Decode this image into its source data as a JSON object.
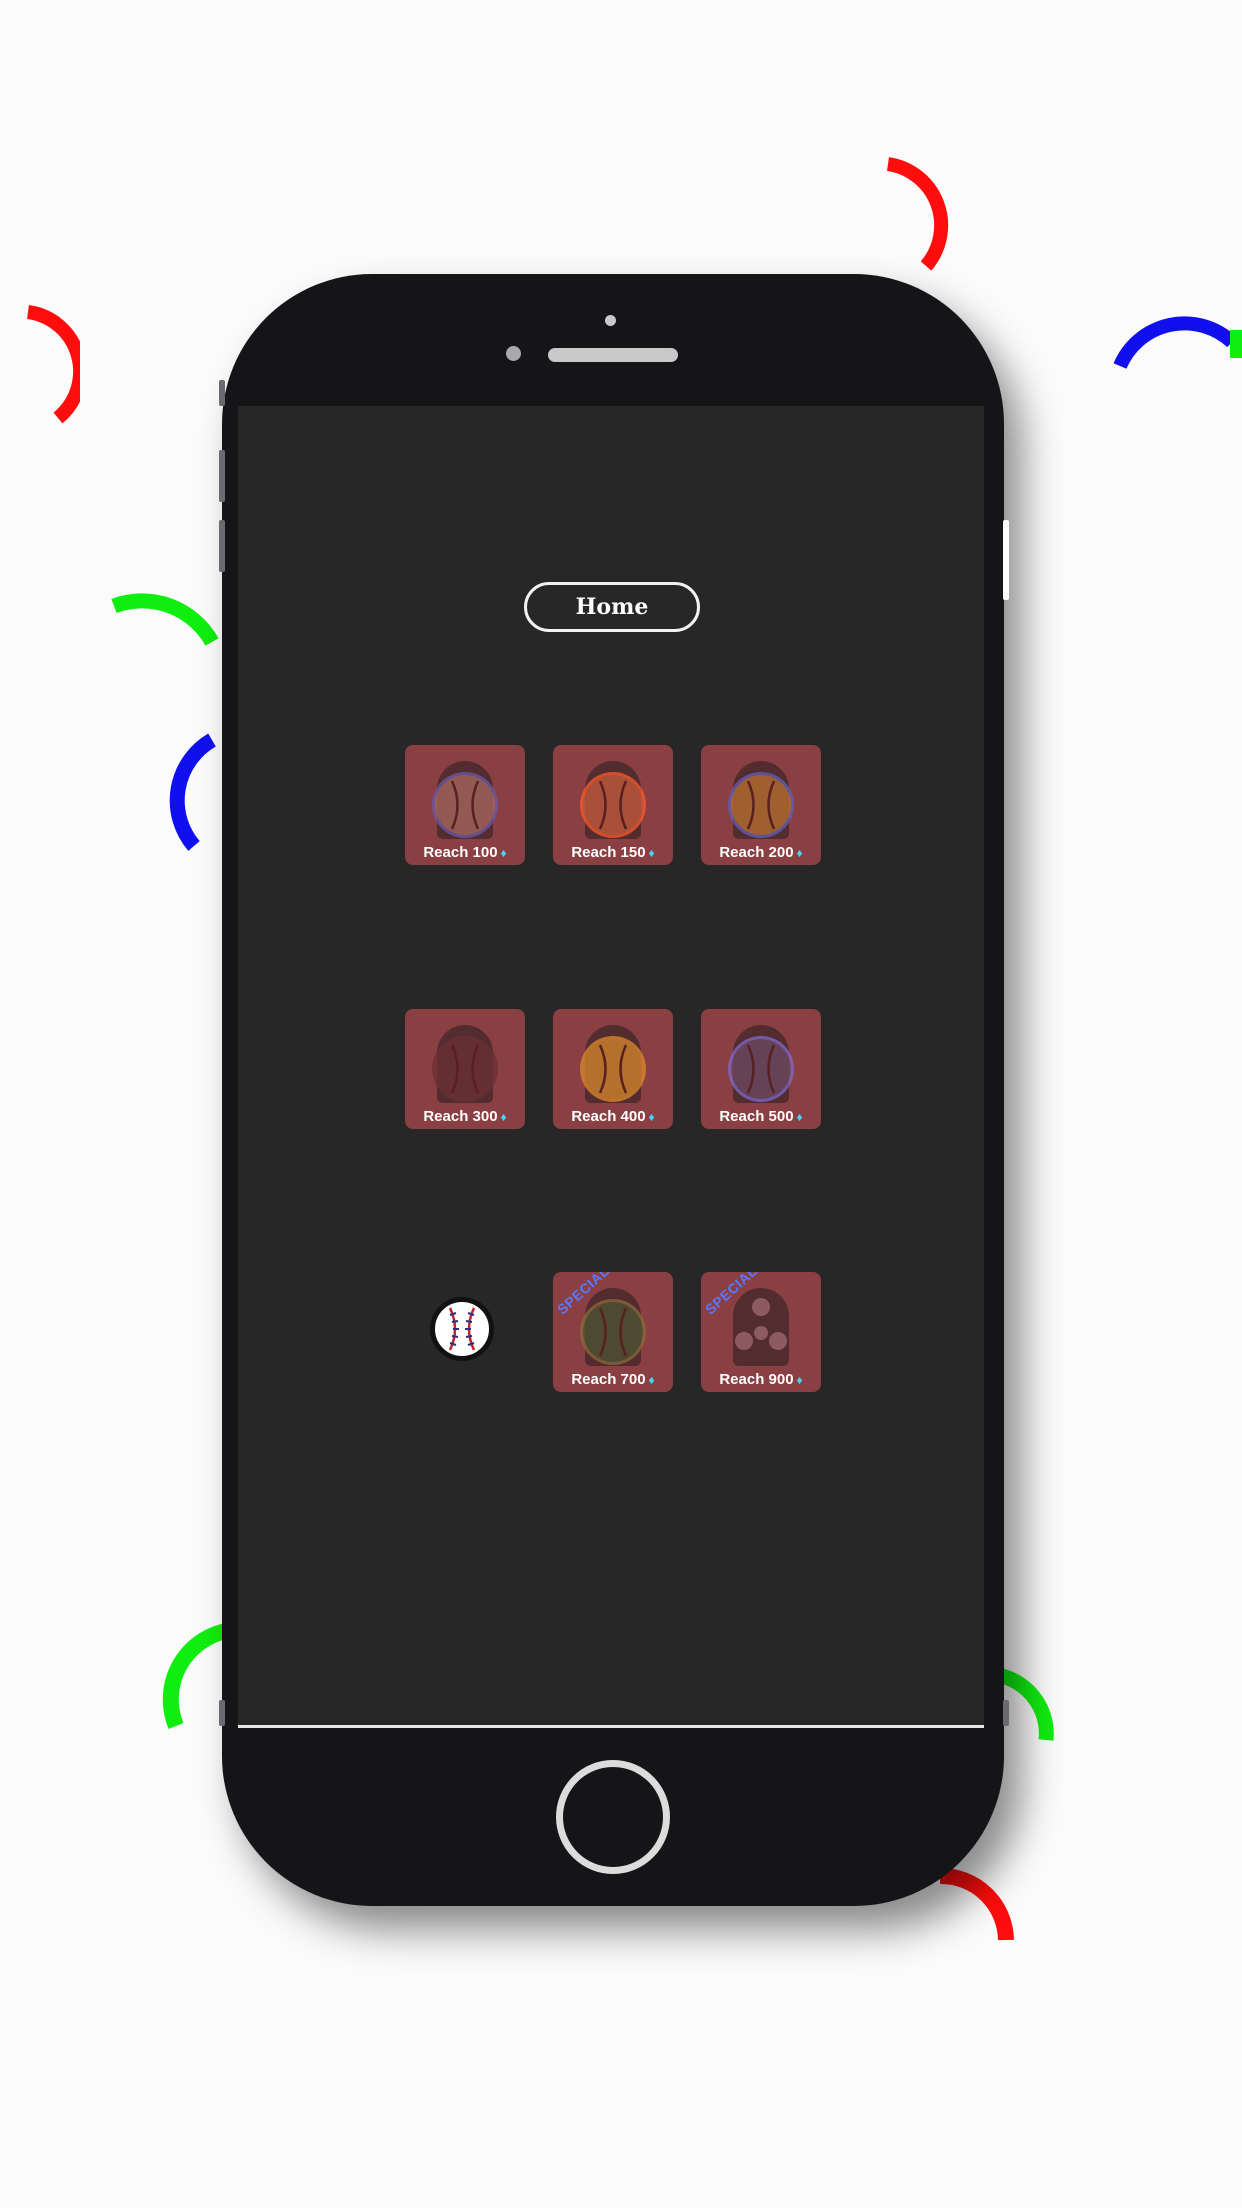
{
  "page": {
    "title": "Home"
  },
  "unlocks": [
    {
      "label": "Reach 100",
      "ball_color": "#a86a60",
      "ring_color": "#6a5ab0"
    },
    {
      "label": "Reach 150",
      "ball_color": "#c85b3c",
      "ring_color": "#ff5a2a"
    },
    {
      "label": "Reach 200",
      "ball_color": "#b9702e",
      "ring_color": "#6060c0"
    },
    {
      "label": "Reach 300",
      "ball_color": "#6b2f35",
      "ring_color": "#6b2f35"
    },
    {
      "label": "Reach 400",
      "ball_color": "#d6872c",
      "ring_color": "#e08a2a"
    },
    {
      "label": "Reach 500",
      "ball_color": "#6d4a64",
      "ring_color": "#7f6ad0"
    },
    {
      "label": "Reach 700",
      "ball_color": "#4d5532",
      "ring_color": "#8a6a3a",
      "badge": "SPECIAL"
    },
    {
      "label": "Reach 900",
      "ball_color": "#4b2a2e",
      "ring_color": "#4b2a2e",
      "badge": "SPECIAL"
    }
  ],
  "colors": {
    "tile": "#8a3f42",
    "screen": "#272727",
    "gem": "#3fd6ff",
    "special_badge": "#5a78ff"
  },
  "icons": {
    "gem": "♦",
    "selected_ball": "baseball-icon"
  }
}
